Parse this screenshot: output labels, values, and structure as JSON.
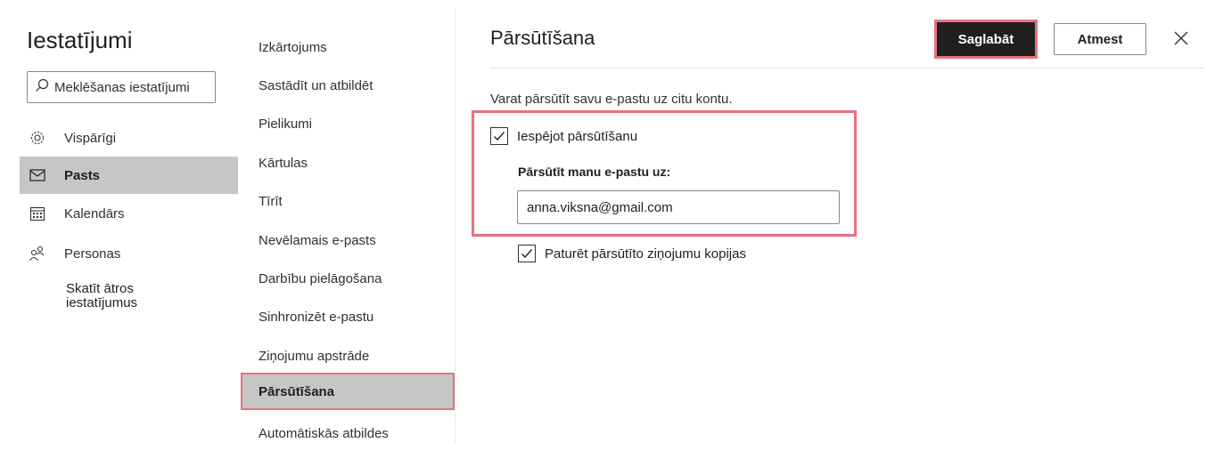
{
  "settings": {
    "title": "Iestatījumi",
    "search_placeholder": "Meklēšanas iestatījumi",
    "nav": [
      {
        "label": "Vispārīgi",
        "icon": "gear-icon"
      },
      {
        "label": "Pasts",
        "icon": "mail-icon",
        "selected": true
      },
      {
        "label": "Kalendārs",
        "icon": "calendar-icon"
      },
      {
        "label": "Personas",
        "icon": "people-icon"
      }
    ],
    "quick_settings": "Skatīt ātros iestatījumus"
  },
  "mail_menu": {
    "items": [
      "Izkārtojums",
      "Sastādīt un atbildēt",
      "Pielikumi",
      "Kārtulas",
      "Tīrīt",
      "Nevēlamais e-pasts",
      "Darbību pielāgošana",
      "Sinhronizēt e-pastu",
      "Ziņojumu apstrāde",
      "Pārsūtīšana",
      "Automātiskās atbildes"
    ],
    "selected_index": 9
  },
  "forwarding": {
    "title": "Pārsūtīšana",
    "save_label": "Saglabāt",
    "discard_label": "Atmest",
    "description": "Varat pārsūtīt savu e-pastu uz citu kontu.",
    "enable_label": "Iespējot pārsūtīšanu",
    "enable_checked": true,
    "forward_to_label": "Pārsūtīt manu e-pastu uz:",
    "forward_to_value": "anna.viksna@gmail.com",
    "keep_copy_label": "Paturēt pārsūtīto ziņojumu kopijas",
    "keep_copy_checked": true
  },
  "colors": {
    "highlight": "#e8727d",
    "selected_bg": "#c8c6c4",
    "primary_button": "#201f1e"
  }
}
